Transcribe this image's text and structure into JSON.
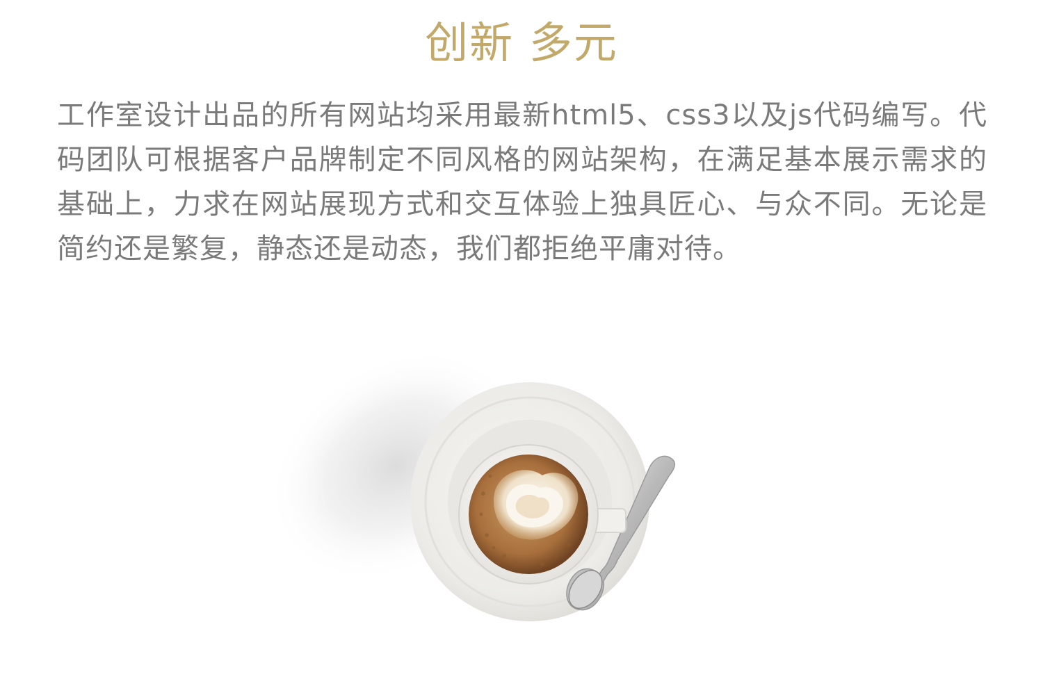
{
  "header": {
    "title": "创新 多元"
  },
  "intro": {
    "text": "工作室设计出品的所有网站均采用最新html5、css3以及js代码编写。代码团队可根据客户品牌制定不同风格的网站架构，在满足基本展示需求的基础上，力求在网站展现方式和交互体验上独具匠心、与众不同。无论是简约还是繁复，静态还是动态，我们都拒绝平庸对待。"
  },
  "colors": {
    "title": "#c2a869",
    "body_text": "#7a7a7a",
    "background": "#ffffff"
  },
  "illustration": {
    "icon": "coffee-cup-icon"
  }
}
